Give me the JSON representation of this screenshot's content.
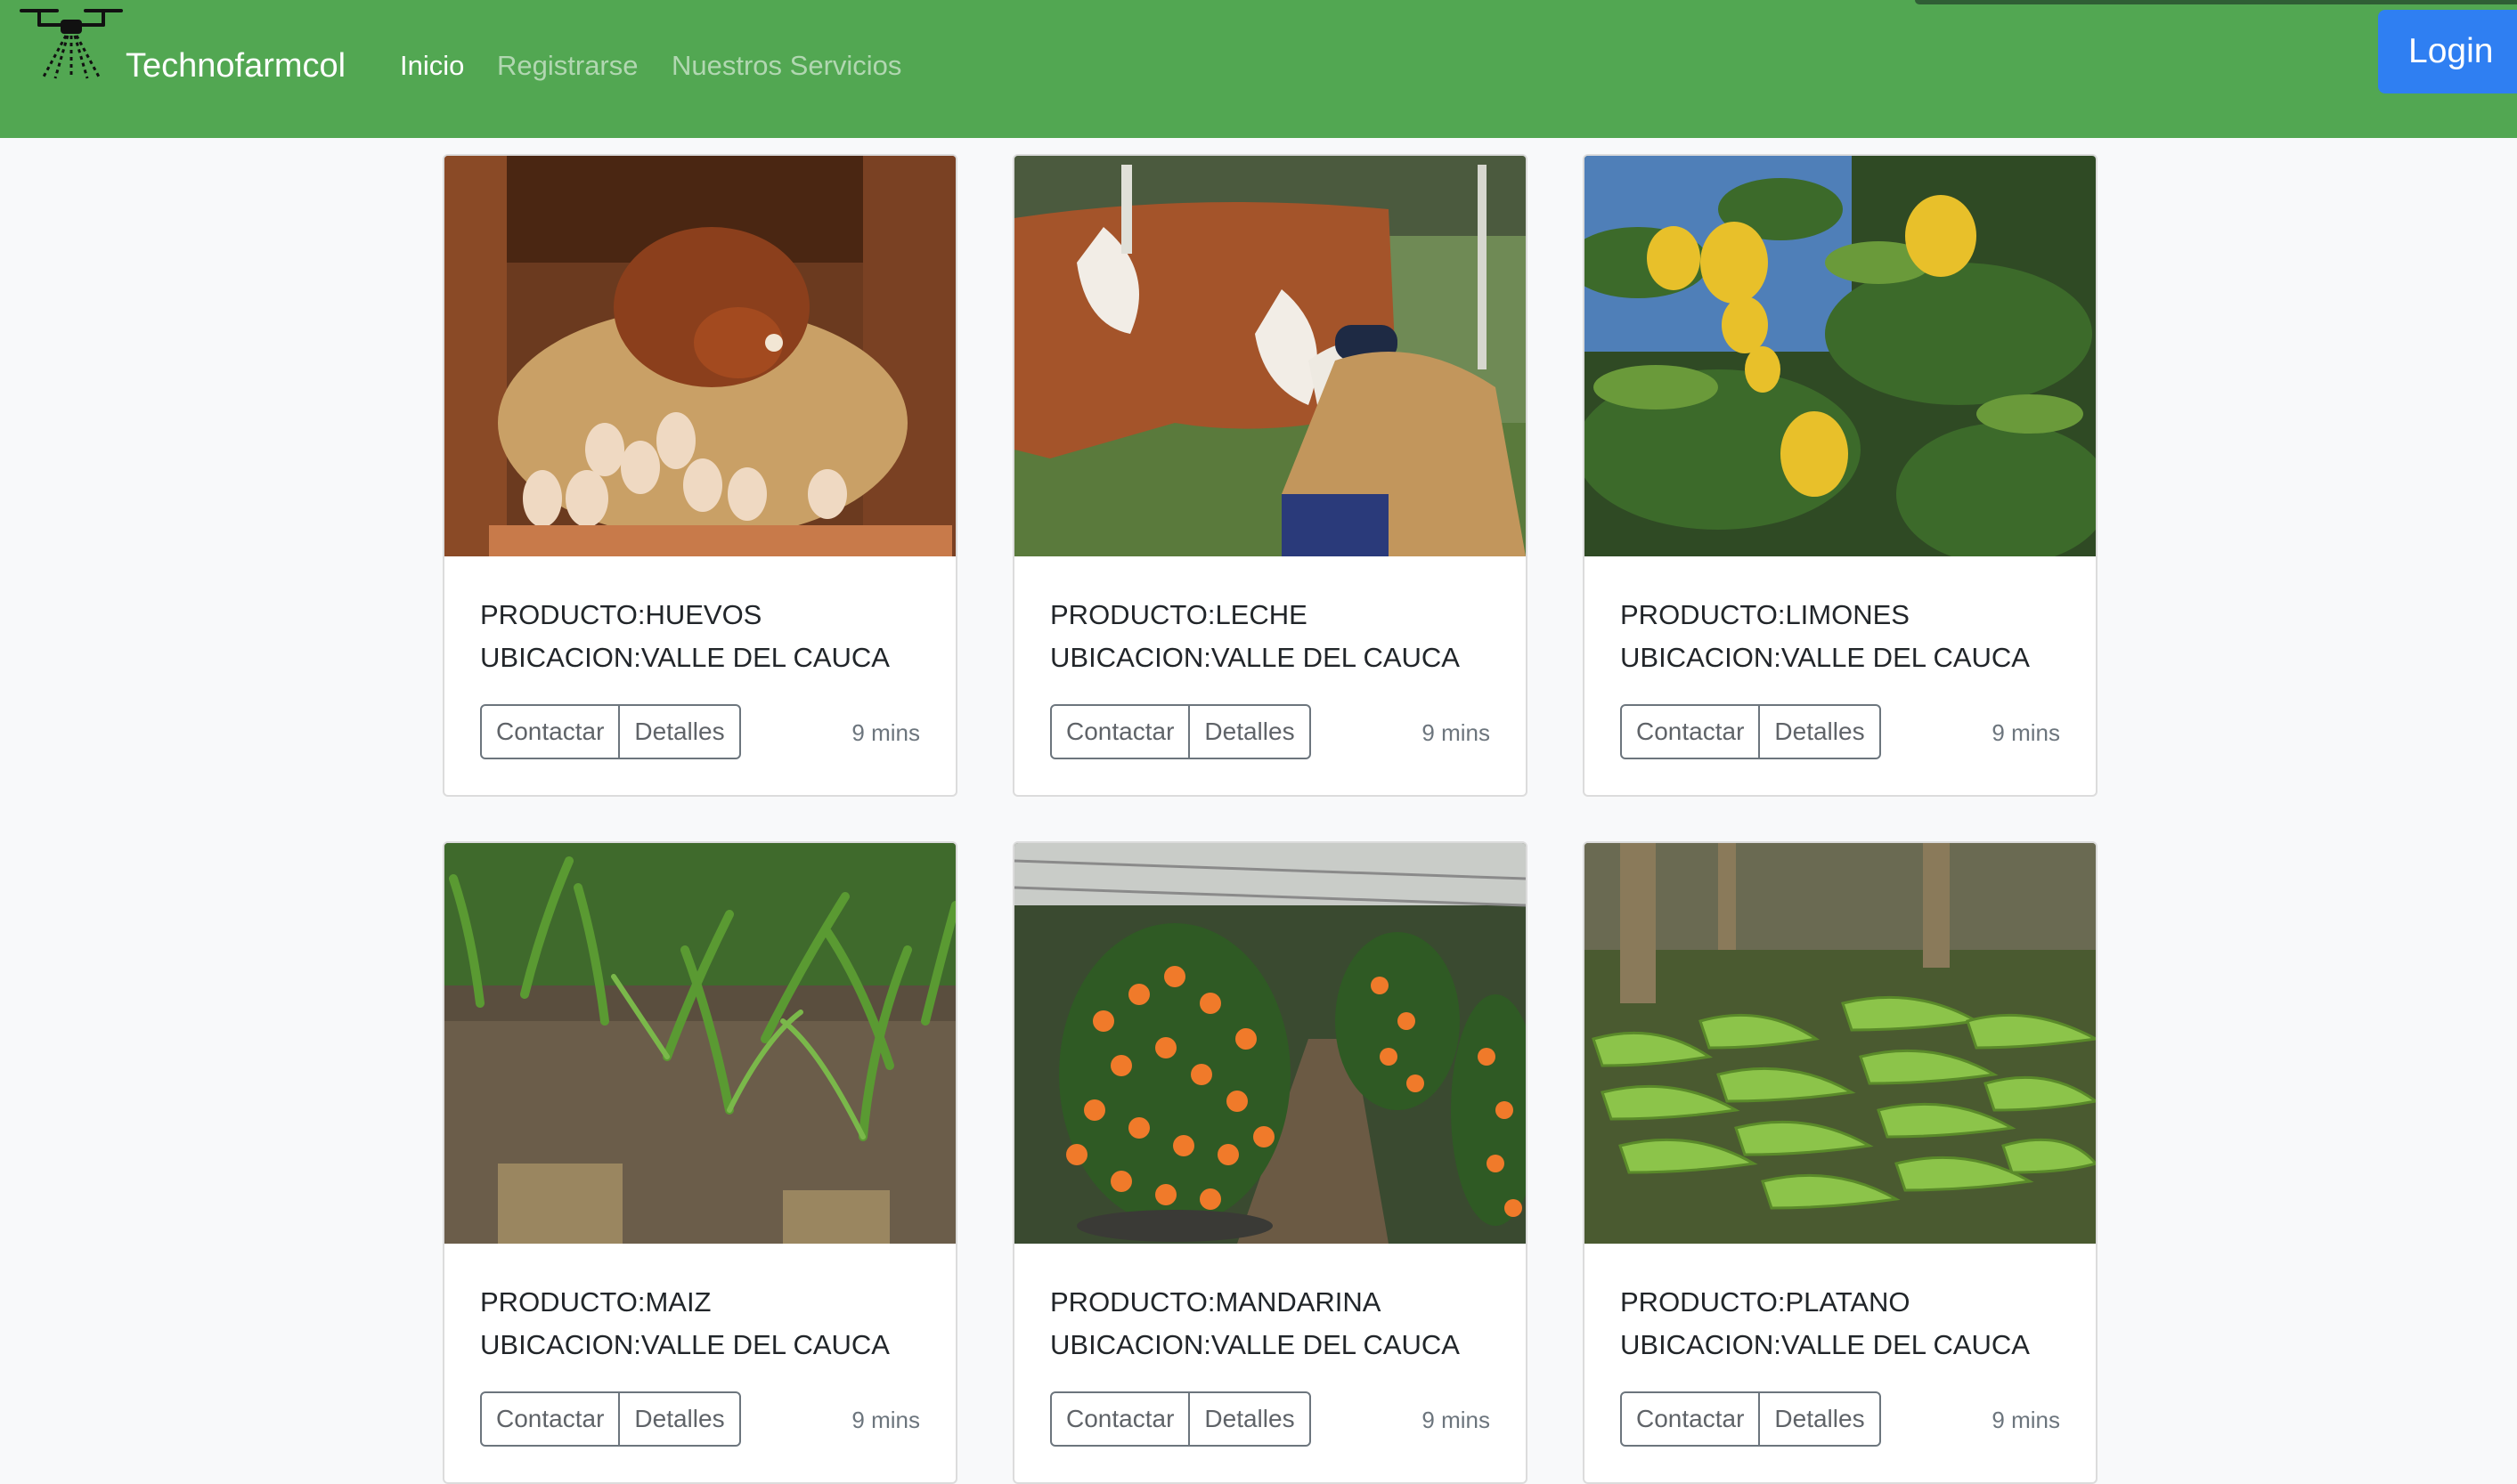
{
  "navbar": {
    "brand": "Technofarmcol",
    "links": [
      "Inicio",
      "Registrarse",
      "Nuestros Servicios"
    ],
    "login": "Login",
    "logo_icon": "drone-sprayer-icon",
    "background": "#52a752"
  },
  "cards": [
    {
      "product": "PRODUCTO:HUEVOS",
      "location": "UBICACION:VALLE DEL CAUCA",
      "contact": "Contactar",
      "details": "Detalles",
      "time": "9 mins",
      "image": "hen-with-eggs-photo"
    },
    {
      "product": "PRODUCTO:LECHE",
      "location": "UBICACION:VALLE DEL CAUCA",
      "contact": "Contactar",
      "details": "Detalles",
      "time": "9 mins",
      "image": "milking-cow-photo"
    },
    {
      "product": "PRODUCTO:LIMONES",
      "location": "UBICACION:VALLE DEL CAUCA",
      "contact": "Contactar",
      "details": "Detalles",
      "time": "9 mins",
      "image": "lemon-tree-photo"
    },
    {
      "product": "PRODUCTO:MAIZ",
      "location": "UBICACION:VALLE DEL CAUCA",
      "contact": "Contactar",
      "details": "Detalles",
      "time": "9 mins",
      "image": "corn-field-photo"
    },
    {
      "product": "PRODUCTO:MANDARINA",
      "location": "UBICACION:VALLE DEL CAUCA",
      "contact": "Contactar",
      "details": "Detalles",
      "time": "9 mins",
      "image": "mandarin-trees-photo"
    },
    {
      "product": "PRODUCTO:PLATANO",
      "location": "UBICACION:VALLE DEL CAUCA",
      "contact": "Contactar",
      "details": "Detalles",
      "time": "9 mins",
      "image": "plantain-bunches-photo"
    }
  ]
}
